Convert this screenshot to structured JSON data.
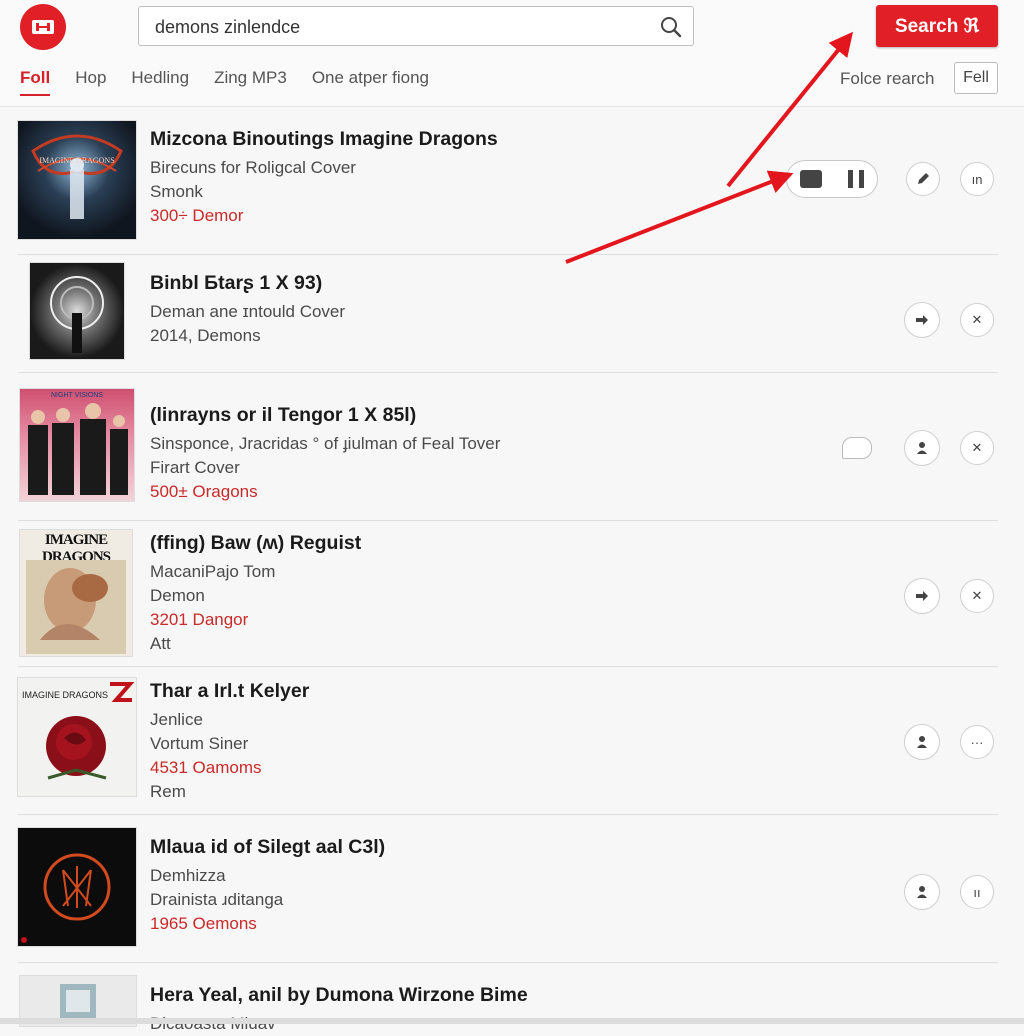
{
  "header": {
    "search_value": "demons zinlendce",
    "search_button_label": "Search ℜ",
    "tabs": [
      {
        "label": "Foll",
        "active": true
      },
      {
        "label": "Hop",
        "active": false
      },
      {
        "label": "Hedling",
        "active": false
      },
      {
        "label": "Zing MP3",
        "active": false
      },
      {
        "label": "One atper fiong",
        "active": false
      }
    ],
    "force_search_label": "Folce rearch",
    "fell_button_label": "Fell"
  },
  "colors": {
    "accent": "#e01f26",
    "highlight_text": "#c92a2a",
    "annotation_arrow": "#e3161d"
  },
  "results": [
    {
      "title": "Mizcona Binoutings Imagine Dragons",
      "line1": "Birecuns for Roligcal Cover",
      "line2": "Smonk",
      "highlight": "300÷ Demor",
      "line4": "",
      "actions": [
        "pill",
        "pen-icon",
        "more-icon"
      ],
      "more_text": "ın"
    },
    {
      "title": "Binbl Бtarʂ 1 X 93)",
      "line1": "Deman ane ɪntould Cover",
      "line2": "2014, Demons",
      "highlight": "",
      "line4": "",
      "actions": [
        "arrow-icon",
        "close-icon"
      ]
    },
    {
      "title": "(linrayns or il Tengor 1 X 85l)",
      "line1": "Sinsponce, Jracridas ° of ɟiulman of Feal Tover",
      "line2": "Firart Cover",
      "highlight": "500± Oragons",
      "line4": "",
      "actions": [
        "chat-icon",
        "user-icon",
        "close-icon"
      ]
    },
    {
      "title": "(ffing) Baw (ʍ) Reguist",
      "line1": "MacaniPajo Tom",
      "line2": "Demon",
      "highlight": "3201 Dangor",
      "line4": "Att",
      "actions": [
        "arrow-icon",
        "close-icon"
      ]
    },
    {
      "title": "Thar a Irl.t Kelyer",
      "line1": "Jenlice",
      "line2": "Vortum Siner",
      "highlight": "4531 Oamoms",
      "line4": "Rem",
      "actions": [
        "user-icon",
        "more-icon"
      ]
    },
    {
      "title": "Mlaua id of Silegt aal C3l)",
      "line1": "Demhizza",
      "line2": "Drainista ɹditanga",
      "highlight": "1965 Oemons",
      "line4": "",
      "actions": [
        "user-icon",
        "more-icon"
      ],
      "more_text": "ıı"
    },
    {
      "title": "Hera Yeal, anil by Dumona Wirzone Bime",
      "line1": "Dicaoasta Miuav",
      "line2": "",
      "highlight": "",
      "line4": "",
      "actions": []
    }
  ],
  "thumb_text": {
    "row1": "IMAGINE DRAGONS",
    "row3": "NIGHT VISIONS",
    "row4": "IMAGINE DRAGONS",
    "row5": "IMAGINE DRAGONS"
  }
}
